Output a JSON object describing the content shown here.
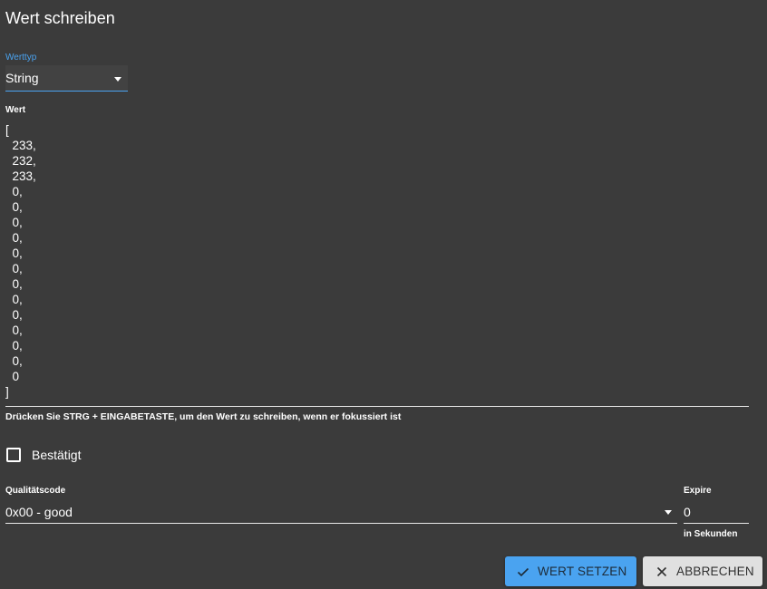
{
  "dialog": {
    "title": "Wert schreiben"
  },
  "type_select": {
    "label": "Werttyp",
    "value": "String"
  },
  "value_field": {
    "label": "Wert",
    "value": "[\n  233,\n  232,\n  233,\n  0,\n  0,\n  0,\n  0,\n  0,\n  0,\n  0,\n  0,\n  0,\n  0,\n  0,\n  0,\n  0\n]",
    "hint": "Drücken Sie STRG + EINGABETASTE, um den Wert zu schreiben, wenn er fokussiert ist"
  },
  "ack": {
    "label": "Bestätigt",
    "checked": false
  },
  "quality": {
    "label": "Qualitätscode",
    "value": "0x00 - good"
  },
  "expire": {
    "label": "Expire",
    "value": "0",
    "helper": "in Sekunden"
  },
  "buttons": {
    "set_label": "WERT SETZEN",
    "set_icon": "check-icon",
    "cancel_label": "ABBRECHEN",
    "cancel_icon": "close-icon"
  },
  "colors": {
    "background": "#3b3b3b",
    "accent": "#4aa3f0",
    "secondary_button": "#e0e0e0"
  }
}
